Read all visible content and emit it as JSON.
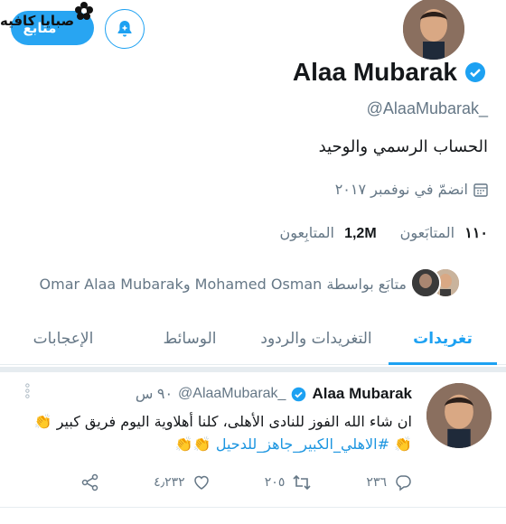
{
  "watermark": "صبايا كافيه",
  "header": {
    "follow_label": "متابع",
    "display_name": "Alaa Mubarak",
    "handle": "@AlaaMubarak_",
    "bio": "الحساب الرسمي والوحيد",
    "joined": "انضمّ في نوفمبر ٢٠١٧"
  },
  "stats": {
    "following_count": "١١٠",
    "following_label": "المتابَعون",
    "followers_count": "1,2M",
    "followers_label": "المتابِعون"
  },
  "followed_by": {
    "text": "متابَع بواسطة Mohamed Osman وOmar Alaa Mubarak"
  },
  "tabs": [
    {
      "label": "تغريدات",
      "active": true
    },
    {
      "label": "التغريدات والردود",
      "active": false
    },
    {
      "label": "الوسائط",
      "active": false
    },
    {
      "label": "الإعجابات",
      "active": false
    }
  ],
  "tweet": {
    "name": "Alaa Mubarak",
    "handle": "@AlaaMubarak_",
    "time": "٩٠ س",
    "text": "ان شاء الله الفوز للنادى الأهلى، كلنا أهلاوية  اليوم فريق كبير",
    "hashtag": "#الاهلي_الكبير_جاهز_للدحيل",
    "replies": "٢٣٦",
    "retweets": "٢٠٥",
    "likes": "٤٫٢٣٢"
  },
  "colors": {
    "accent": "#1da1f2",
    "muted": "#657786",
    "verified": "#1da1f2"
  }
}
